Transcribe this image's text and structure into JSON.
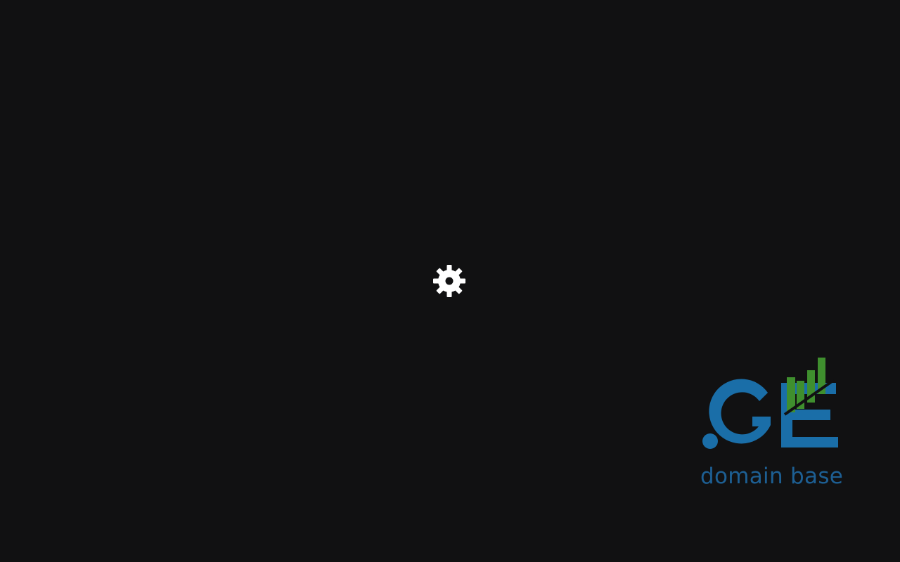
{
  "loader": {
    "icon": "gear-icon",
    "color": "#ffffff"
  },
  "brand": {
    "logo_text": ".GE",
    "tagline": "domain base",
    "primary_color": "#1a6ea8",
    "accent_color": "#3f8f2e",
    "tagline_color": "#1d5f93"
  }
}
